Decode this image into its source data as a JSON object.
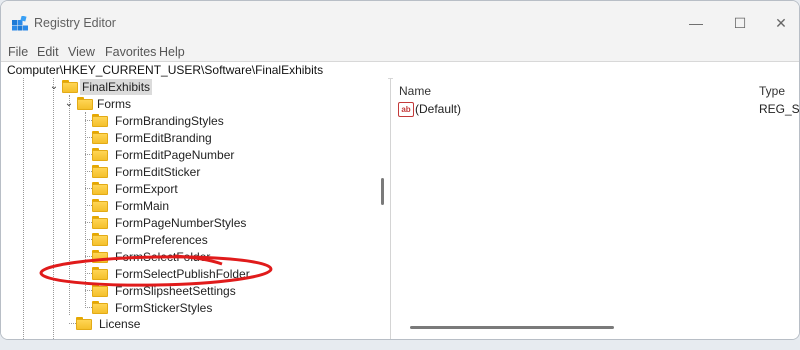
{
  "window": {
    "title": "Registry Editor",
    "controls": {
      "minimize": "—",
      "maximize": "☐",
      "close": "✕"
    }
  },
  "menu": [
    "File",
    "Edit",
    "View",
    "Favorites",
    "Help"
  ],
  "address": "Computer\\HKEY_CURRENT_USER\\Software\\FinalExhibits",
  "tree": {
    "root": "FinalExhibits",
    "forms": "Forms",
    "children": [
      "FormBrandingStyles",
      "FormEditBranding",
      "FormEditPageNumber",
      "FormEditSticker",
      "FormExport",
      "FormMain",
      "FormPageNumberStyles",
      "FormPreferences",
      "FormSelectFolder",
      "FormSelectPublishFolder",
      "FormSlipsheetSettings",
      "FormStickerStyles"
    ],
    "license": "License"
  },
  "values": {
    "columns": {
      "name": "Name",
      "type": "Type"
    },
    "rows": [
      {
        "name": "(Default)",
        "type": "REG_S"
      }
    ]
  },
  "colors": {
    "highlight_ellipse": "#e01b1b",
    "folder": "#f4c02c",
    "selection": "#dbdbdb"
  }
}
